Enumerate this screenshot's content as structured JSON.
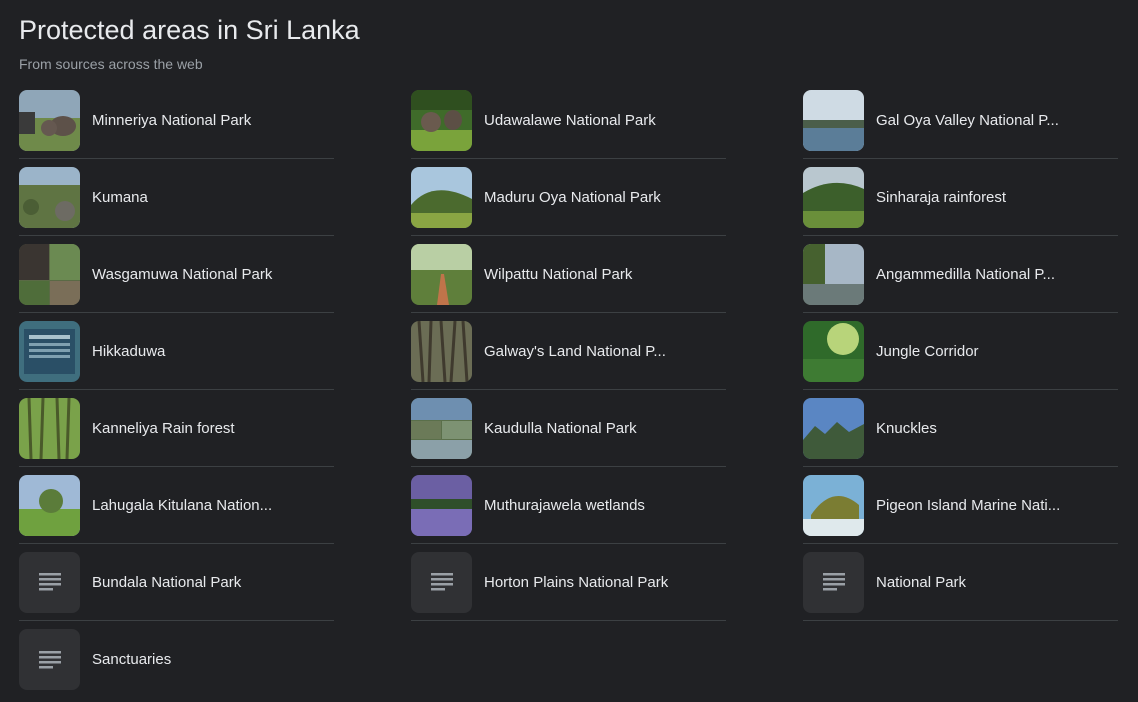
{
  "header": {
    "title": "Protected areas in Sri Lanka",
    "subtitle": "From sources across the web"
  },
  "items": [
    {
      "label": "Minneriya National Park",
      "thumb": "photo"
    },
    {
      "label": "Udawalawe National Park",
      "thumb": "photo"
    },
    {
      "label": "Gal Oya Valley National P...",
      "thumb": "photo"
    },
    {
      "label": "Kumana",
      "thumb": "photo"
    },
    {
      "label": "Maduru Oya National Park",
      "thumb": "photo"
    },
    {
      "label": "Sinharaja rainforest",
      "thumb": "photo"
    },
    {
      "label": "Wasgamuwa National Park",
      "thumb": "photo"
    },
    {
      "label": "Wilpattu National Park",
      "thumb": "photo"
    },
    {
      "label": "Angammedilla National P...",
      "thumb": "photo"
    },
    {
      "label": "Hikkaduwa",
      "thumb": "photo"
    },
    {
      "label": "Galway's Land National P...",
      "thumb": "photo"
    },
    {
      "label": "Jungle Corridor",
      "thumb": "photo"
    },
    {
      "label": "Kanneliya Rain forest",
      "thumb": "photo"
    },
    {
      "label": "Kaudulla National Park",
      "thumb": "photo"
    },
    {
      "label": "Knuckles",
      "thumb": "photo"
    },
    {
      "label": "Lahugala Kitulana Nation...",
      "thumb": "photo"
    },
    {
      "label": "Muthurajawela wetlands",
      "thumb": "photo"
    },
    {
      "label": "Pigeon Island Marine Nati...",
      "thumb": "photo"
    },
    {
      "label": "Bundala National Park",
      "thumb": "document-icon"
    },
    {
      "label": "Horton Plains National Park",
      "thumb": "document-icon"
    },
    {
      "label": "National Park",
      "thumb": "document-icon"
    },
    {
      "label": "Sanctuaries",
      "thumb": "document-icon"
    }
  ]
}
